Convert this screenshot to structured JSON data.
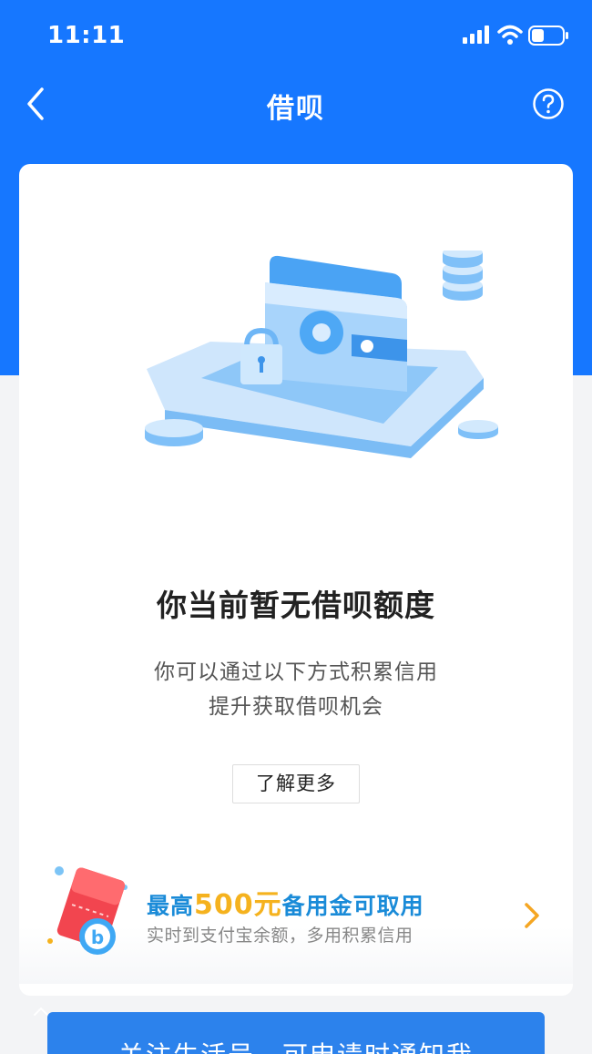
{
  "status_bar": {
    "time": "11:11",
    "icons": [
      "signal-icon",
      "wifi-icon",
      "battery-icon"
    ]
  },
  "nav": {
    "title": "借呗",
    "back_icon": "chevron-left-icon",
    "help_icon": "question-circle-icon"
  },
  "card": {
    "illustration": "wallet-lock-illustration",
    "headline": "你当前暂无借呗额度",
    "desc_line1": "你可以通过以下方式积累信用",
    "desc_line2": "提升获取借呗机会",
    "learn_more": "了解更多"
  },
  "promo": {
    "title_prefix": "最高",
    "title_amount": "500元",
    "title_suffix": "备用金可取用",
    "subtitle": "实时到支付宝余额，多用积累信用",
    "icon": "red-ticket-b-icon"
  },
  "footer": {
    "button": "关注生活号，可申请时通知我"
  },
  "colors": {
    "primary": "#1677ff",
    "promo_blue": "#1a8bd8",
    "promo_amount": "#f5b21e",
    "chevron": "#f5a623"
  }
}
